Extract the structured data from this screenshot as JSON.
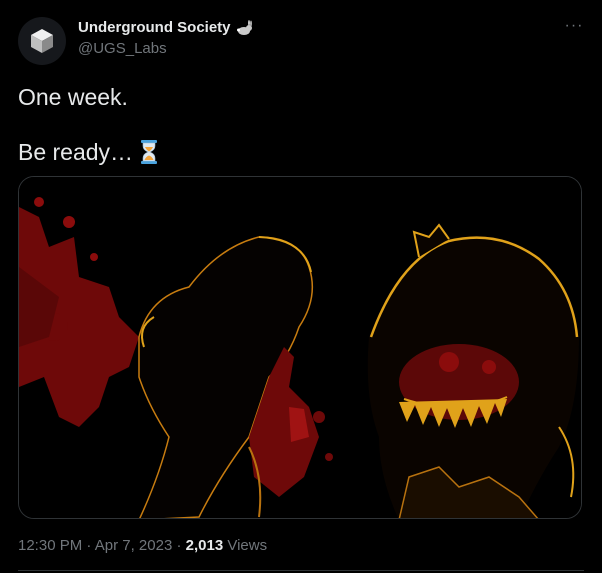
{
  "account": {
    "display_name": "Underground Society",
    "handle": "@UGS_Labs",
    "badge_icon": "rabbit-icon"
  },
  "tweet": {
    "line1": "One week.",
    "line2": "Be ready…",
    "emoji": "hourglass-icon"
  },
  "meta": {
    "time": "12:30 PM",
    "separator1": " · ",
    "date": "Apr 7, 2023",
    "separator2": " · ",
    "views_count": "2,013",
    "views_label": " Views"
  },
  "colors": {
    "background": "#000000",
    "text_primary": "#e7e9ea",
    "text_secondary": "#71767b",
    "border": "#2f3336",
    "art_red": "#8b0c0c",
    "art_gold": "#e0a21a"
  }
}
